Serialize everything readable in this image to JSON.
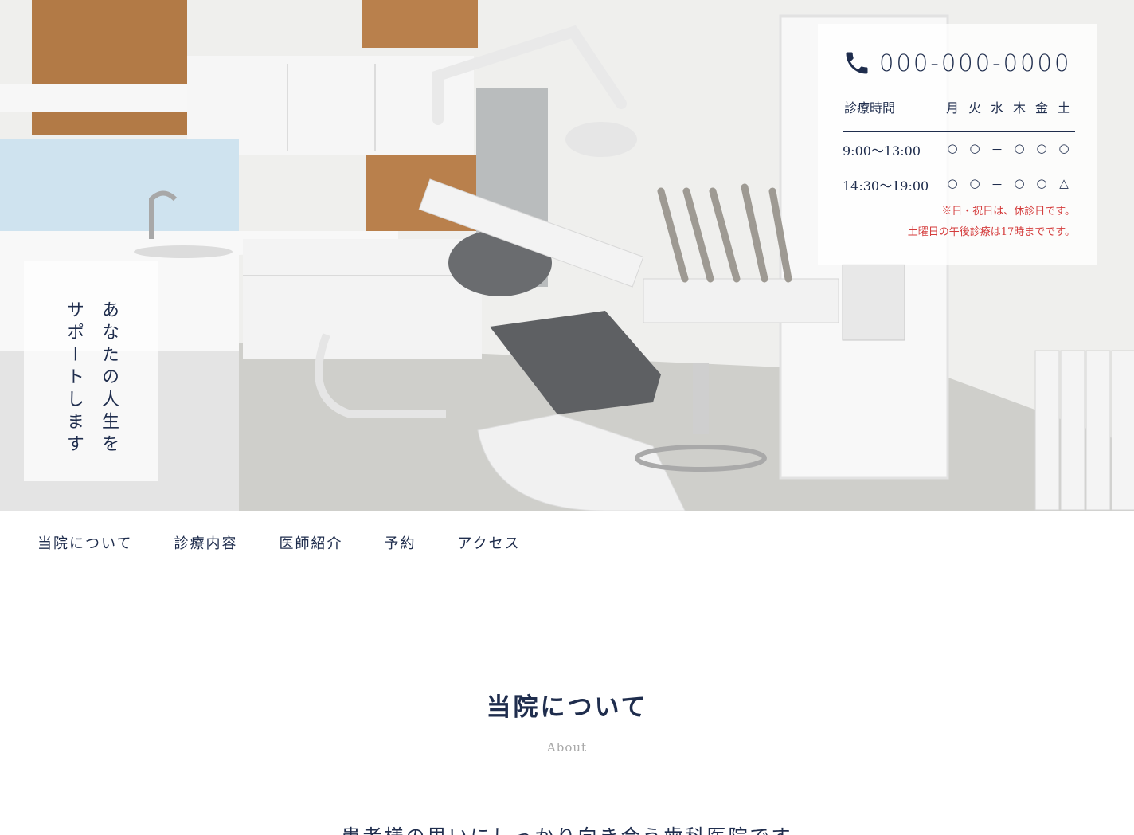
{
  "hero": {
    "catch_copy": "あなたの人生を\nサポートします"
  },
  "info": {
    "phone": "000-000-0000",
    "hours_label": "診療時間",
    "days": [
      "月",
      "火",
      "水",
      "木",
      "金",
      "土"
    ],
    "rows": [
      {
        "time": "9:00〜13:00",
        "marks": [
          "○",
          "○",
          "－",
          "○",
          "○",
          "○"
        ]
      },
      {
        "time": "14:30〜19:00",
        "marks": [
          "○",
          "○",
          "－",
          "○",
          "○",
          "△"
        ]
      }
    ],
    "notes": [
      "※日・祝日は、休診日です。",
      "土曜日の午後診療は17時までです。"
    ],
    "accent_color": "#d43b3b",
    "text_color": "#1f2d4d"
  },
  "nav": {
    "items": [
      "当院について",
      "診療内容",
      "医師紹介",
      "予約",
      "アクセス"
    ]
  },
  "about": {
    "title": "当院について",
    "subtitle": "About",
    "lead": "患者様の思いにしっかり向き合う歯科医院です"
  }
}
